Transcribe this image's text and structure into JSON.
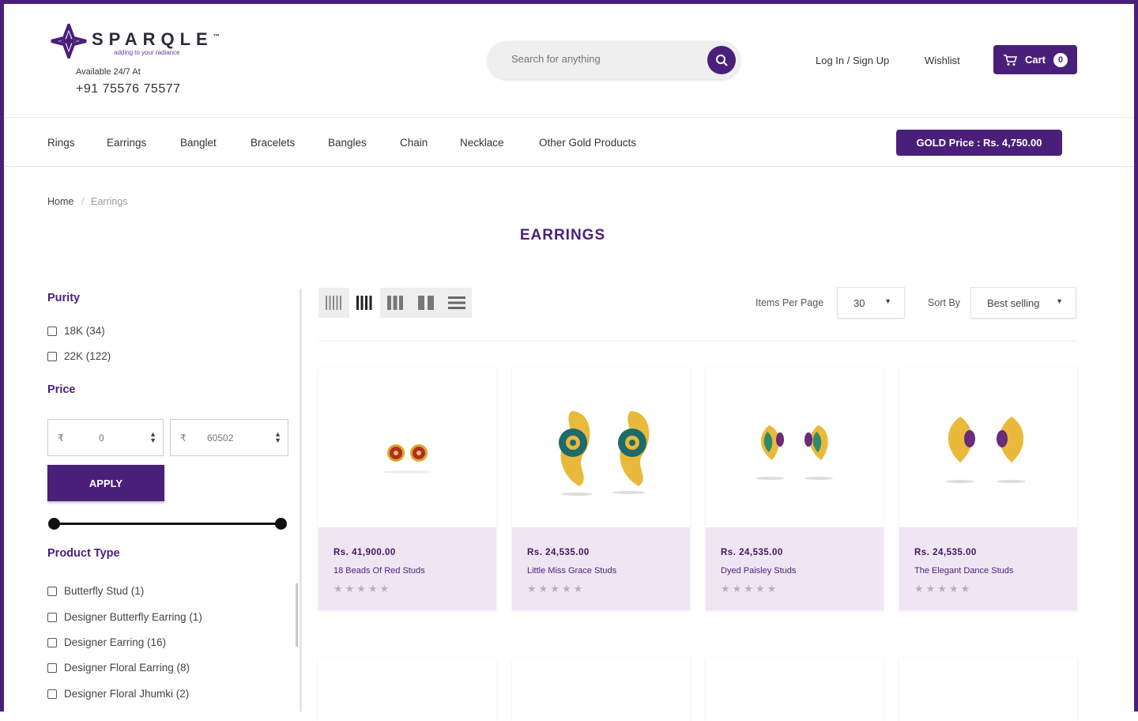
{
  "brand": {
    "name": "SPARQLE",
    "trademark": "™",
    "tagline": "adding to your radiance",
    "availability": "Available 24/7 At",
    "phone": "+91 75576 75577"
  },
  "search": {
    "placeholder": "Search for anything"
  },
  "header": {
    "login": "Log In / Sign Up",
    "wishlist": "Wishlist",
    "cart_label": "Cart",
    "cart_count": "0"
  },
  "nav": {
    "items": [
      "Rings",
      "Earrings",
      "Banglet",
      "Bracelets",
      "Bangles",
      "Chain",
      "Necklace",
      "Other Gold Products"
    ],
    "gold_price": "GOLD Price : Rs. 4,750.00"
  },
  "breadcrumb": [
    "Home",
    "Earrings"
  ],
  "page_title": "EARRINGS",
  "filters": {
    "purity_title": "Purity",
    "purity": [
      "18K (34)",
      "22K (122)"
    ],
    "price_title": "Price",
    "currency": "₹",
    "price_min": "0",
    "price_max": "60502",
    "apply": "APPLY",
    "product_type_title": "Product Type",
    "product_types": [
      "Butterfly Stud (1)",
      "Designer Butterfly Earring (1)",
      "Designer Earring (16)",
      "Designer Floral Earring (8)",
      "Designer Floral Jhumki (2)"
    ]
  },
  "toolbar": {
    "items_per_page_label": "Items Per Page",
    "items_per_page": "30",
    "sort_label": "Sort By",
    "sort_value": "Best selling"
  },
  "products": [
    {
      "price": "Rs. 41,900.00",
      "name": "18 Beads Of Red Studs",
      "rating": 0
    },
    {
      "price": "Rs. 24,535.00",
      "name": "Little Miss Grace Studs",
      "rating": 0
    },
    {
      "price": "Rs. 24,535.00",
      "name": "Dyed Paisley Studs",
      "rating": 0
    },
    {
      "price": "Rs. 24,535.00",
      "name": "The Elegant Dance Studs",
      "rating": 0
    }
  ],
  "colors": {
    "brand": "#4a1f7a",
    "card_info": "#efe6f4",
    "gold": "#e8b93a"
  },
  "icons": [
    "search-icon",
    "cart-icon",
    "grid-5-icon",
    "grid-4-icon",
    "grid-3-icon",
    "grid-2-icon",
    "list-view-icon",
    "star-icon"
  ]
}
